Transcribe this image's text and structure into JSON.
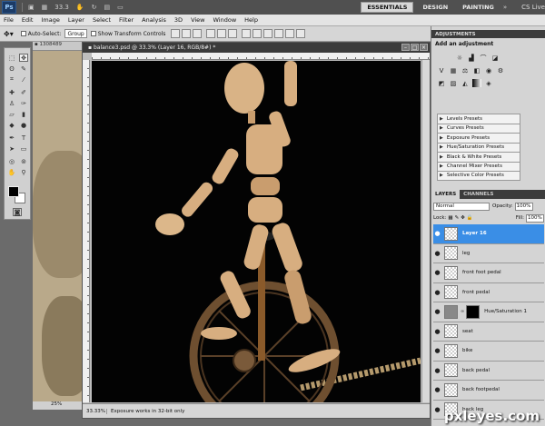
{
  "appbar": {
    "logo": "Ps",
    "zoom": "33.3",
    "workspaces": [
      "ESSENTIALS",
      "DESIGN",
      "PAINTING"
    ],
    "active_workspace": "ESSENTIALS",
    "more": "»",
    "cs_live": "CS Live"
  },
  "menu": [
    "File",
    "Edit",
    "Image",
    "Layer",
    "Select",
    "Filter",
    "Analysis",
    "3D",
    "View",
    "Window",
    "Help"
  ],
  "options": {
    "auto_select_label": "Auto-Select:",
    "auto_select_value": "Group",
    "show_transform_label": "Show Transform Controls"
  },
  "background_doc": {
    "title": "1308489",
    "zoom": "25%"
  },
  "document": {
    "title": "balance3.psd @ 33.3% (Layer 16, RGB/8#) *",
    "zoom": "33.33%",
    "status": "Exposure works in 32-bit only"
  },
  "adjustments": {
    "panel_title": "ADJUSTMENTS",
    "heading": "Add an adjustment",
    "presets": [
      "Levels Presets",
      "Curves Presets",
      "Exposure Presets",
      "Hue/Saturation Presets",
      "Black & White Presets",
      "Channel Mixer Presets",
      "Selective Color Presets"
    ]
  },
  "layers": {
    "tabs": [
      "LAYERS",
      "CHANNELS"
    ],
    "blend_mode": "Normal",
    "opacity_label": "Opacity:",
    "opacity": "100%",
    "lock_label": "Lock:",
    "fill_label": "Fill:",
    "fill": "100%",
    "items": [
      {
        "name": "Layer 16",
        "selected": true,
        "type": "pixel"
      },
      {
        "name": "leg",
        "selected": false,
        "type": "pixel"
      },
      {
        "name": "front foot pedal",
        "selected": false,
        "type": "pixel"
      },
      {
        "name": "front pedal",
        "selected": false,
        "type": "pixel"
      },
      {
        "name": "Hue/Saturation 1",
        "selected": false,
        "type": "adjustment"
      },
      {
        "name": "seat",
        "selected": false,
        "type": "pixel"
      },
      {
        "name": "bike",
        "selected": false,
        "type": "pixel"
      },
      {
        "name": "back pedal",
        "selected": false,
        "type": "pixel"
      },
      {
        "name": "back footpedal",
        "selected": false,
        "type": "pixel"
      },
      {
        "name": "back leg",
        "selected": false,
        "type": "pixel"
      }
    ]
  },
  "watermark": "pxleyes.com",
  "colors": {
    "selection": "#3a8ee6",
    "canvas": "#030303",
    "wood": "#d7ae80"
  }
}
